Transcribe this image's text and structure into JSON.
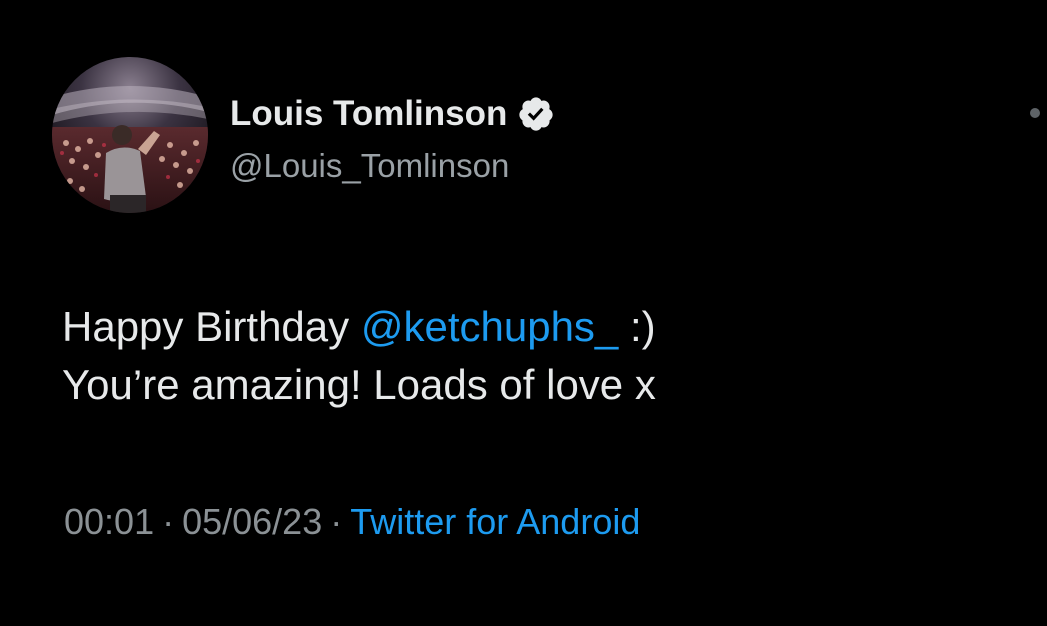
{
  "author": {
    "display_name": "Louis Tomlinson",
    "handle": "@Louis_Tomlinson",
    "verified": true
  },
  "icons": {
    "verified": "verified-badge-icon",
    "more": "more-options-icon"
  },
  "tweet": {
    "line1_prefix": "Happy Birthday ",
    "mention": "@ketchuphs_",
    "line1_suffix": " :)",
    "line2": "You’re amazing! Loads of love x"
  },
  "meta": {
    "time": "00:01",
    "separator": "·",
    "date": "05/06/23",
    "source": "Twitter for Android"
  },
  "colors": {
    "background": "#000000",
    "text_primary": "#e7e9ea",
    "text_secondary": "#8b9195",
    "link": "#1d9bf0"
  }
}
